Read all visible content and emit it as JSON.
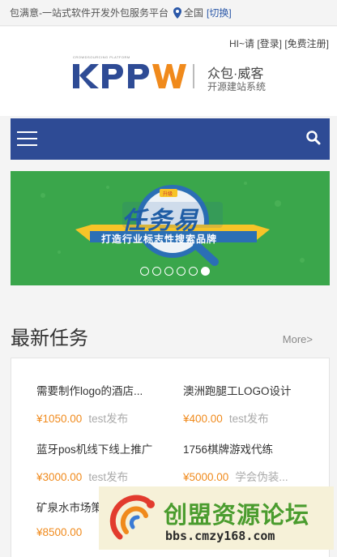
{
  "topbar": {
    "slogan": "包满意-一站式软件开发外包服务平台",
    "region": "全国",
    "switch": "[切换]"
  },
  "header": {
    "greeting": "HI~请",
    "login": "[登录]",
    "register": "[免费注册]"
  },
  "logo": {
    "mark": "KPPW",
    "small_text": "CROWDSOURCING PLATFORM",
    "name": "众包·威客",
    "tagline": "开源建站系统"
  },
  "banner": {
    "badge": "升级",
    "title": "任务易",
    "slogan": "打造行业标志性搜索品牌",
    "slide_count": 6,
    "active_slide": 6
  },
  "section": {
    "title": "最新任务",
    "more": "More>"
  },
  "tasks": [
    {
      "title": "需要制作logo的酒店...",
      "price": "¥1050.00",
      "publisher": "test发布"
    },
    {
      "title": "澳洲跑腿工LOGO设计",
      "price": "¥400.00",
      "publisher": "test发布"
    },
    {
      "title": "蓝牙pos机线下线上推广",
      "price": "¥3000.00",
      "publisher": "test发布"
    },
    {
      "title": "1756棋牌游戏代练",
      "price": "¥5000.00",
      "publisher": "学会伪装..."
    },
    {
      "title": "矿泉水市场策",
      "price": "¥8500.00",
      "publisher": ""
    }
  ],
  "watermark": {
    "text": "创盟资源论坛",
    "url": "bbs.cmzy168.com"
  },
  "colors": {
    "nav": "#2e4b95",
    "price": "#f08a1c",
    "banner": "#3aa64b"
  }
}
